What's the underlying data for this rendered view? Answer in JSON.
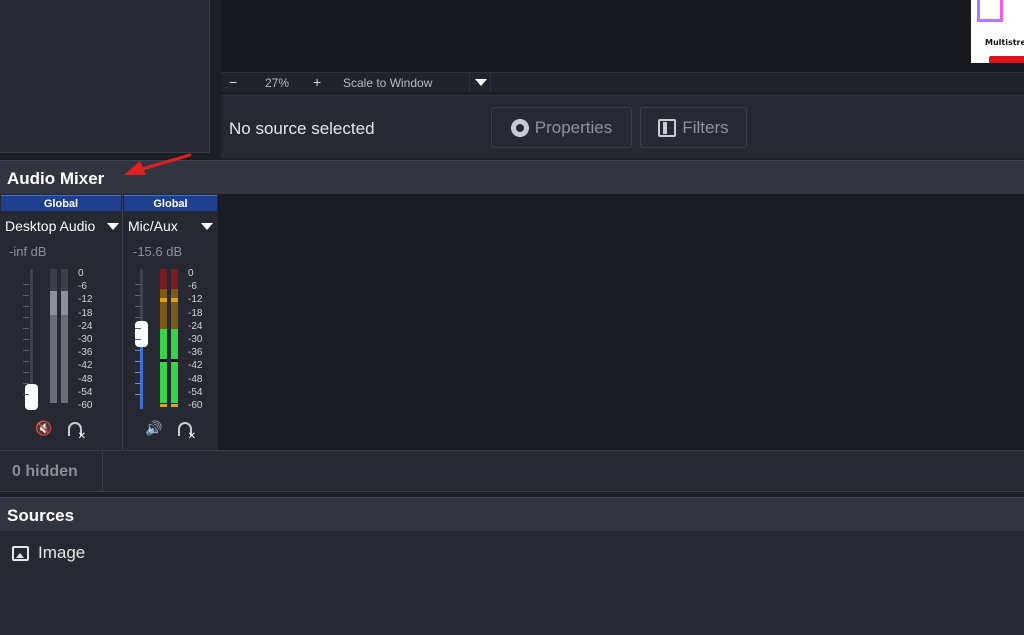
{
  "preview": {
    "thumb_text": "Multistre",
    "zoom_minus": "−",
    "zoom_value": "27%",
    "zoom_plus": "+",
    "scale_mode": "Scale to Window"
  },
  "context_bar": {
    "no_source": "No source selected",
    "properties_label": "Properties",
    "filters_label": "Filters"
  },
  "mixer": {
    "title": "Audio Mixer",
    "channels": [
      {
        "badge": "Global",
        "name": "Desktop Audio",
        "db": "-inf dB",
        "muted": true,
        "fader_level": 0.1,
        "meter_peak": 0.83
      },
      {
        "badge": "Global",
        "name": "Mic/Aux",
        "db": "-15.6 dB",
        "muted": false,
        "fader_level": 0.57,
        "meter_peak": 1.0
      }
    ],
    "scale_labels": [
      "0",
      "-6",
      "-12",
      "-18",
      "-24",
      "-30",
      "-36",
      "-42",
      "-48",
      "-54",
      "-60"
    ],
    "hidden_count": "0 hidden"
  },
  "sources": {
    "title": "Sources",
    "items": [
      {
        "label": "Image",
        "icon": "image-icon"
      }
    ]
  },
  "colors": {
    "accent_blue": "#1f3f8f",
    "meter_green": "#3ad24a",
    "meter_yellow": "#e0a21a",
    "meter_red": "#b0232a",
    "annotation_arrow": "#e02020"
  }
}
